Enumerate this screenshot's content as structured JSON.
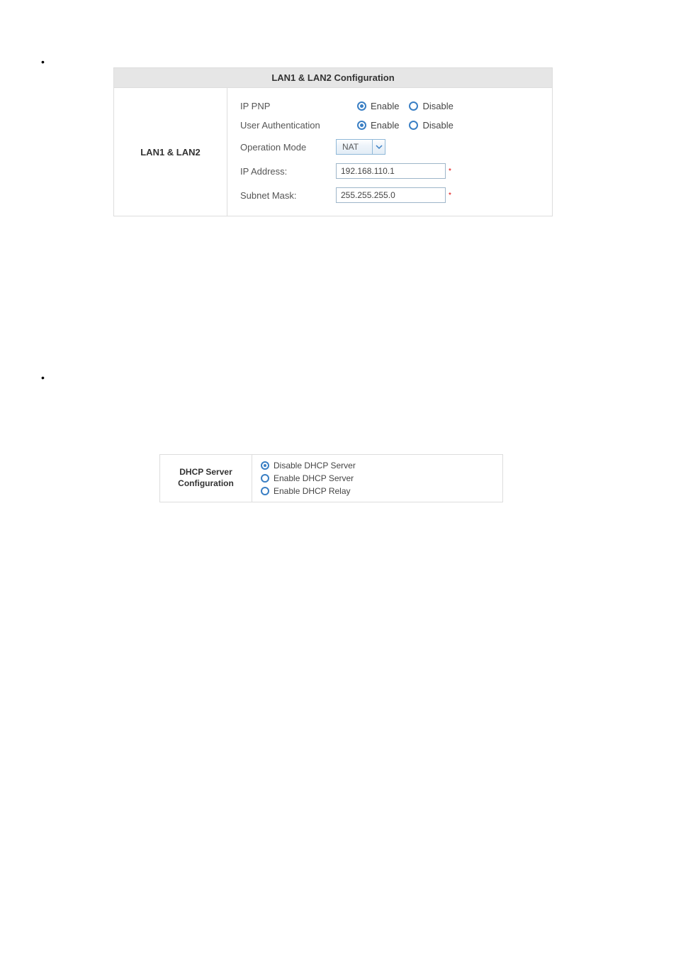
{
  "lan": {
    "header": "LAN1 & LAN2 Configuration",
    "section_label": "LAN1 & LAN2",
    "rows": {
      "ip_pnp": {
        "label": "IP PNP",
        "enable": "Enable",
        "disable": "Disable",
        "selected": "enable"
      },
      "user_auth": {
        "label": "User Authentication",
        "enable": "Enable",
        "disable": "Disable",
        "selected": "enable"
      },
      "op_mode": {
        "label": "Operation Mode",
        "value": "NAT"
      },
      "ip_addr": {
        "label": "IP Address:",
        "value": "192.168.110.1"
      },
      "subnet": {
        "label": "Subnet Mask:",
        "value": "255.255.255.0"
      }
    }
  },
  "dhcp": {
    "section_label_l1": "DHCP Server",
    "section_label_l2": "Configuration",
    "options": {
      "disable": "Disable DHCP Server",
      "enable_server": "Enable DHCP Server",
      "enable_relay": "Enable DHCP Relay",
      "selected": "disable"
    }
  }
}
